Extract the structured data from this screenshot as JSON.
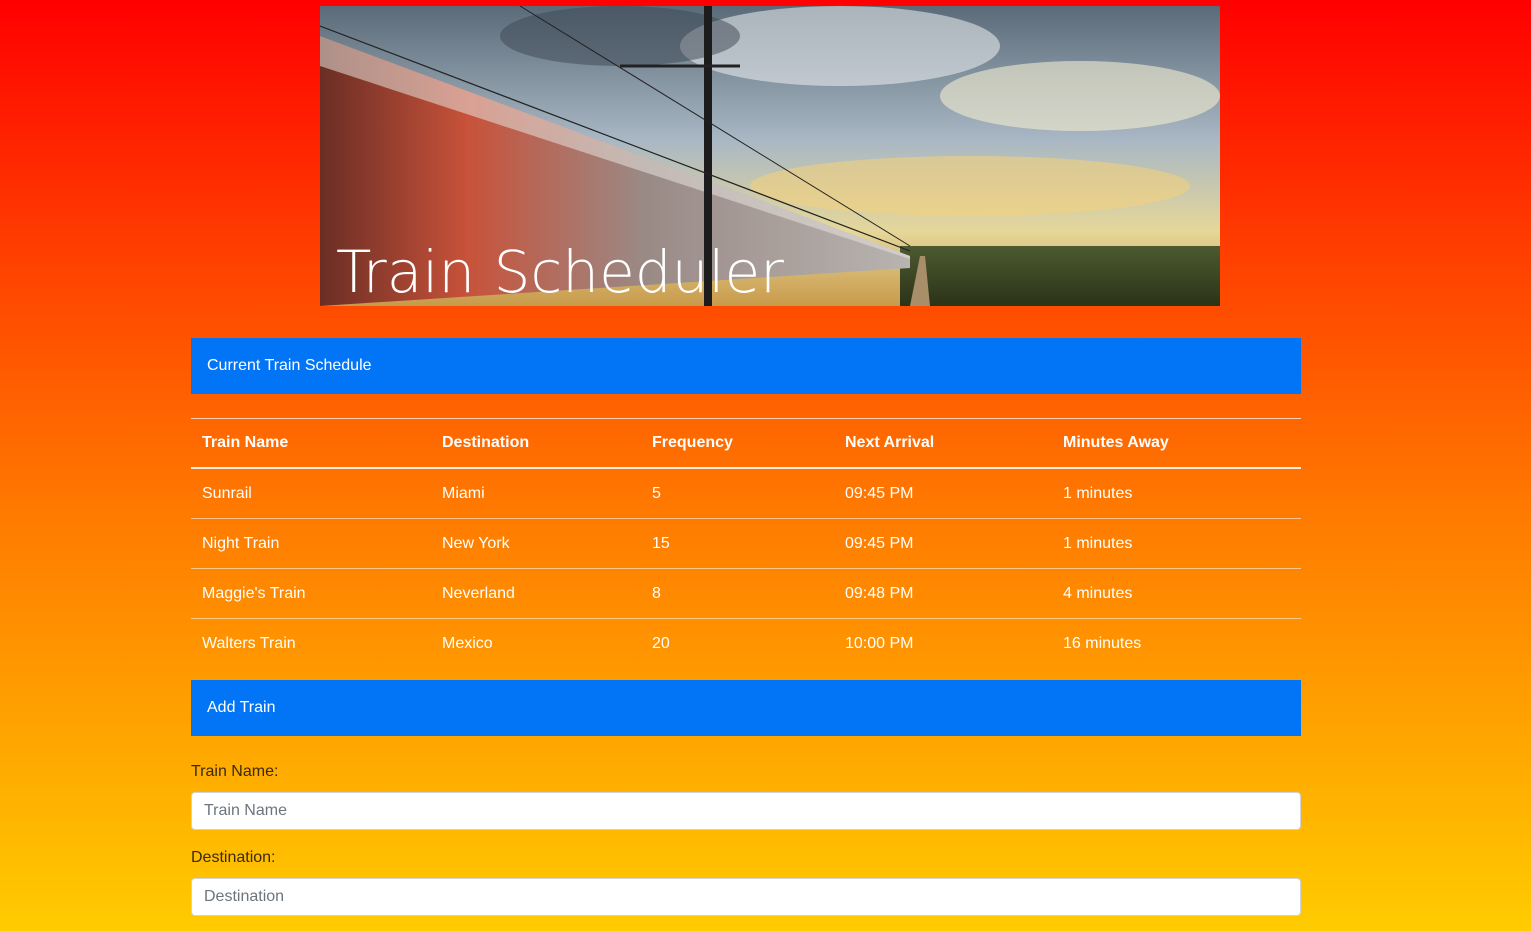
{
  "hero": {
    "title": "Train Scheduler"
  },
  "schedule": {
    "header": "Current Train Schedule",
    "columns": [
      "Train Name",
      "Destination",
      "Frequency",
      "Next Arrival",
      "Minutes Away"
    ],
    "rows": [
      [
        "Sunrail",
        "Miami",
        "5",
        "09:45 PM",
        "1 minutes"
      ],
      [
        "Night Train",
        "New York",
        "15",
        "09:45 PM",
        "1 minutes"
      ],
      [
        "Maggie's Train",
        "Neverland",
        "8",
        "09:48 PM",
        "4 minutes"
      ],
      [
        "Walters Train",
        "Mexico",
        "20",
        "10:00 PM",
        "16 minutes"
      ]
    ]
  },
  "add_train": {
    "header": "Add Train",
    "train_name_label": "Train Name:",
    "train_name_placeholder": "Train Name",
    "destination_label": "Destination:",
    "destination_placeholder": "Destination"
  },
  "colors": {
    "panel_header": "#0275f7",
    "gradient_top": "#ff0000",
    "gradient_bottom": "#ffcc00"
  }
}
